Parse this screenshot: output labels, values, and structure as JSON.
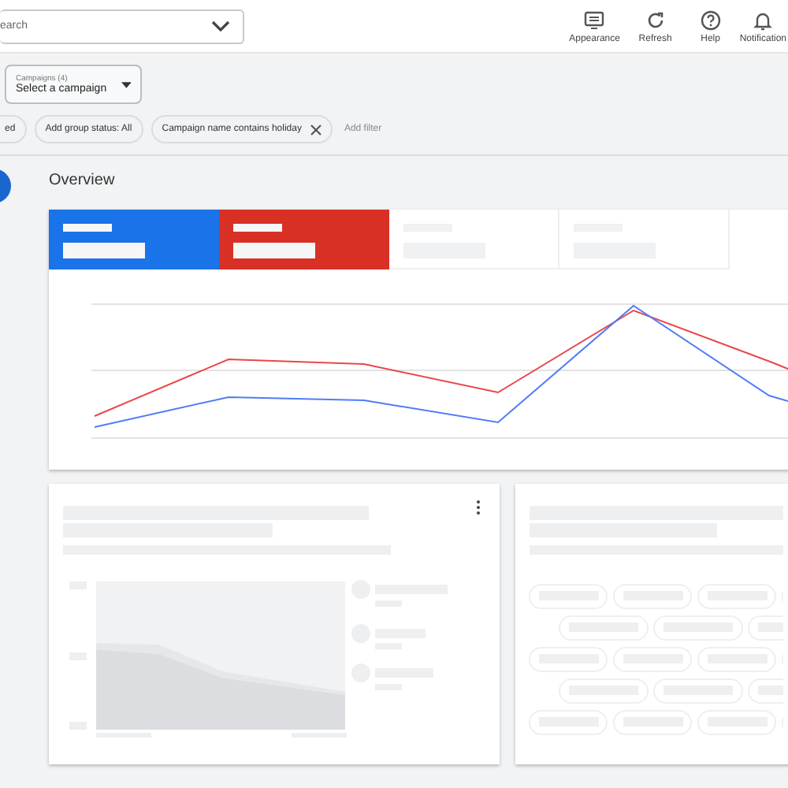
{
  "search": {
    "placeholder": "earch"
  },
  "top_actions": [
    {
      "kind": "appearance",
      "label": "Appearance"
    },
    {
      "kind": "refresh",
      "label": "Refresh"
    },
    {
      "kind": "help",
      "label": "Help"
    },
    {
      "kind": "notifications",
      "label": "Notification"
    }
  ],
  "campaign_selector": {
    "label": "Campaigns (4)",
    "value": "Select a campaign"
  },
  "filters": [
    {
      "label": "ed",
      "removable": false
    },
    {
      "label": "Add group status: All",
      "removable": false
    },
    {
      "label": "Campaign name contains holiday",
      "removable": true
    }
  ],
  "add_filter": "Add filter",
  "section_title": "Overview",
  "metric_tiles": [
    {
      "selected": true,
      "color": "#1a73e8"
    },
    {
      "selected": true,
      "color": "#d93025"
    },
    {
      "selected": false
    },
    {
      "selected": false
    }
  ]
}
